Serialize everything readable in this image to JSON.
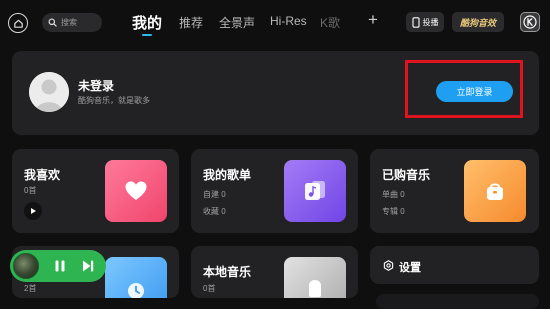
{
  "topbar": {
    "search_placeholder": "搜索",
    "tabs": [
      {
        "label": "我的",
        "active": true
      },
      {
        "label": "推荐",
        "active": false
      },
      {
        "label": "全景声",
        "active": false
      },
      {
        "label": "Hi-Res",
        "active": false
      },
      {
        "label": "K歌",
        "active": false
      }
    ],
    "plus_symbol": "+",
    "cast_label": "投播",
    "vip_label": "酷狗音效",
    "k_logo": "K"
  },
  "login": {
    "title": "未登录",
    "subtitle": "酷狗音乐，就是歌多",
    "button_label": "立即登录"
  },
  "tiles": {
    "favorites": {
      "title": "我喜欢",
      "count": "0首"
    },
    "playlists": {
      "title": "我的歌单",
      "created": "自建 0",
      "collected": "收藏 0"
    },
    "purchased": {
      "title": "已购音乐",
      "singles": "单曲 0",
      "albums": "专辑 0"
    },
    "recent": {
      "count": "2首"
    },
    "local": {
      "title": "本地音乐",
      "count": "0首"
    },
    "settings": {
      "label": "设置"
    }
  },
  "colors": {
    "accent_blue": "#1f9ff2",
    "tab_indicator": "#2fb7f0",
    "highlight_red": "#e0141e",
    "player_green": "#2eb451",
    "card_bg": "#222224",
    "page_bg": "#0f0f10"
  }
}
